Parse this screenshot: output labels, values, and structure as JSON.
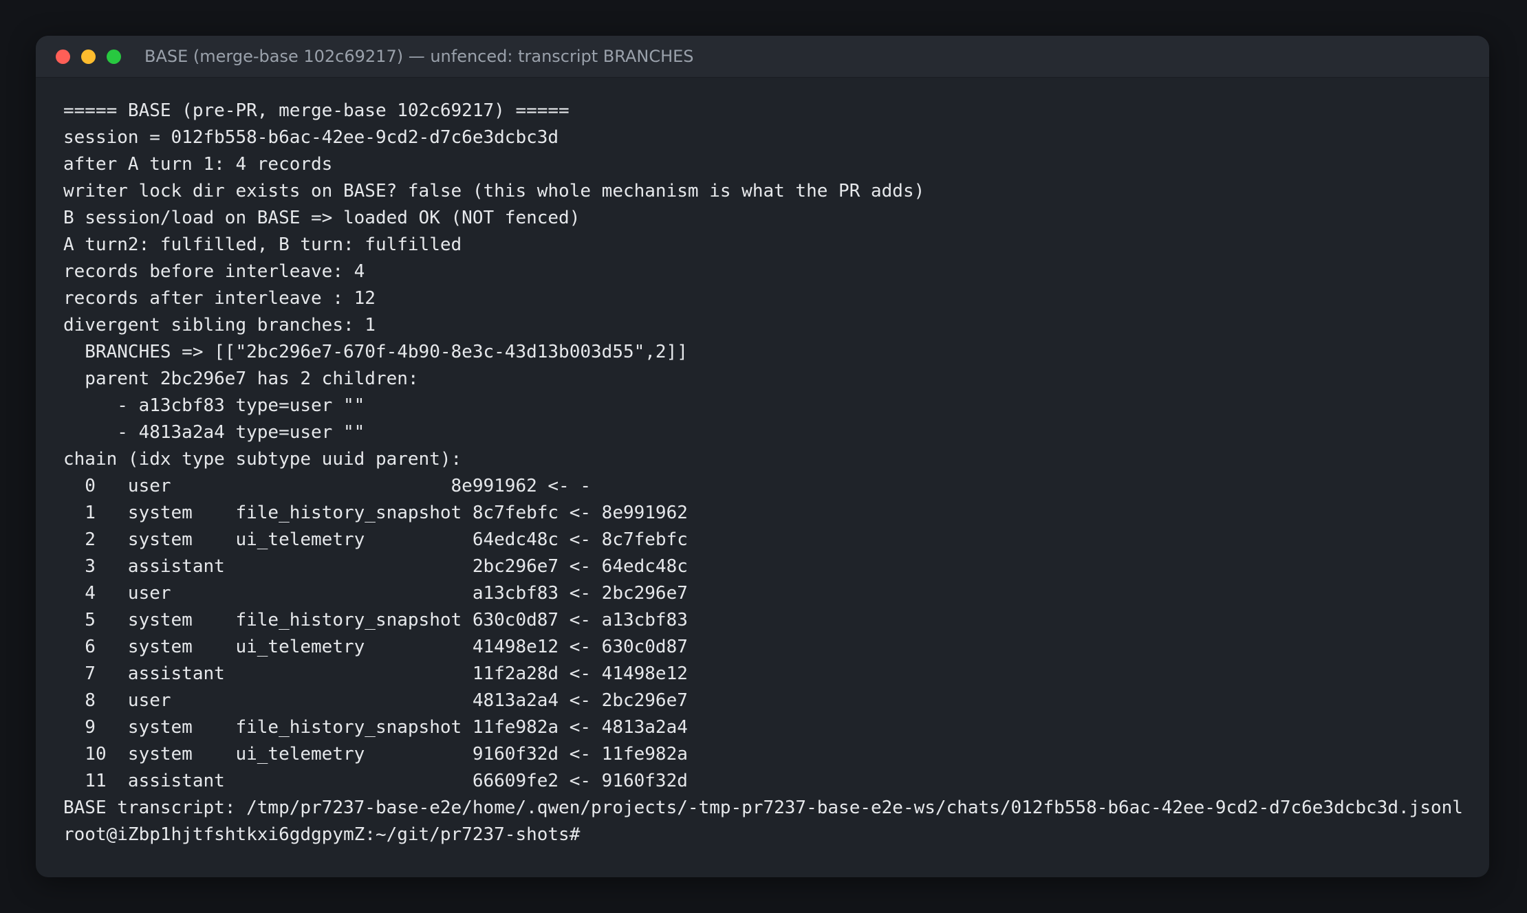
{
  "window": {
    "title": "BASE (merge-base 102c69217) — unfenced: transcript BRANCHES"
  },
  "terminal": {
    "lines": [
      "===== BASE (pre-PR, merge-base 102c69217) =====",
      "session = 012fb558-b6ac-42ee-9cd2-d7c6e3dcbc3d",
      "after A turn 1: 4 records",
      "writer lock dir exists on BASE? false (this whole mechanism is what the PR adds)",
      "B session/load on BASE => loaded OK (NOT fenced)",
      "A turn2: fulfilled, B turn: fulfilled",
      "records before interleave: 4",
      "records after interleave : 12",
      "divergent sibling branches: 1",
      "  BRANCHES => [[\"2bc296e7-670f-4b90-8e3c-43d13b003d55\",2]]",
      "  parent 2bc296e7 has 2 children:",
      "     - a13cbf83 type=user \"\"",
      "     - 4813a2a4 type=user \"\"",
      "chain (idx type subtype uuid parent):",
      "  0   user                          8e991962 <- -",
      "  1   system    file_history_snapshot 8c7febfc <- 8e991962",
      "  2   system    ui_telemetry          64edc48c <- 8c7febfc",
      "  3   assistant                       2bc296e7 <- 64edc48c",
      "  4   user                            a13cbf83 <- 2bc296e7",
      "  5   system    file_history_snapshot 630c0d87 <- a13cbf83",
      "  6   system    ui_telemetry          41498e12 <- 630c0d87",
      "  7   assistant                       11f2a28d <- 41498e12",
      "  8   user                            4813a2a4 <- 2bc296e7",
      "  9   system    file_history_snapshot 11fe982a <- 4813a2a4",
      "  10  system    ui_telemetry          9160f32d <- 11fe982a",
      "  11  assistant                       66609fe2 <- 9160f32d",
      "BASE transcript: /tmp/pr7237-base-e2e/home/.qwen/projects/-tmp-pr7237-base-e2e-ws/chats/012fb558-b6ac-42ee-9cd2-d7c6e3dcbc3d.jsonl",
      "root@iZbp1hjtfshtkxi6gdgpymZ:~/git/pr7237-shots# "
    ]
  },
  "colors": {
    "background": "#121418",
    "window": "#1f2329",
    "titlebar": "#262a31",
    "text": "#e6e8eb",
    "title_text": "#9aa1ab",
    "close": "#ff5f57",
    "minimize": "#febc2e",
    "zoom": "#28c840"
  }
}
